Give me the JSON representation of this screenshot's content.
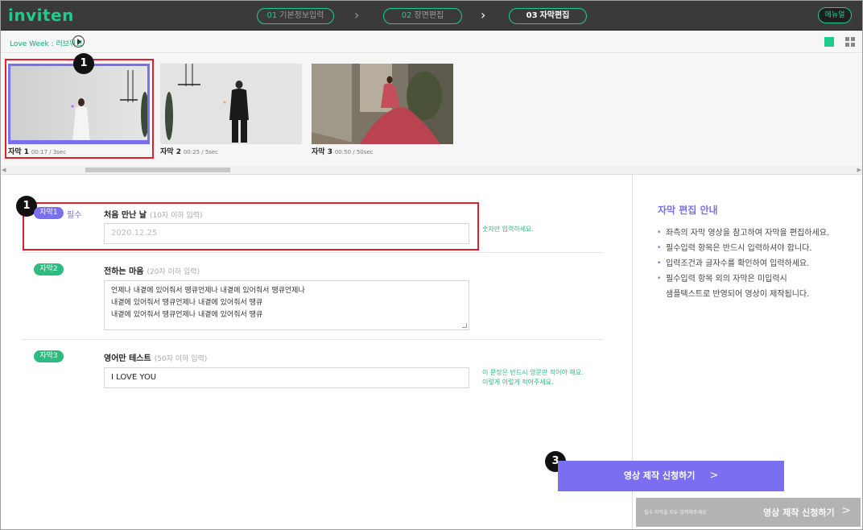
{
  "header": {
    "logo": "inviten",
    "steps": [
      {
        "num": "01",
        "label": "기본정보입력"
      },
      {
        "num": "02",
        "label": "장면편집"
      },
      {
        "num": "03",
        "label": "자막편집"
      }
    ],
    "menu_label": "메뉴얼",
    "accent": "#1dcc8c"
  },
  "subbar": {
    "project_title": "Love Week : 러브위크"
  },
  "filmstrip": {
    "thumbs": [
      {
        "name": "자막 1",
        "meta": "00:17 / 3sec"
      },
      {
        "name": "자막 2",
        "meta": "00:25 / 5sec"
      },
      {
        "name": "자막 3",
        "meta": "00:50 / 50sec"
      }
    ]
  },
  "annotations": {
    "badge1": "1",
    "badge1b": "1",
    "badge3": "3"
  },
  "form": {
    "rows": [
      {
        "tag": "자막1",
        "required": "필수",
        "title": "처음 만난 날",
        "hint": "(10자 이하 입력)",
        "placeholder": "2020.12.25",
        "side_hint": "숫자만 입력하세요."
      },
      {
        "tag": "자막2",
        "title": "전하는 마음",
        "hint": "(20자 이하 입력)",
        "lines": [
          "언제나 내곁에 있어줘서 땡큐언제나 내곁에 있어줘서 땡큐언제나",
          "내곁에 있어줘서 땡큐언제나 내곁에 있어줘서 땡큐",
          "내곁에 있어줘서 땡큐언제나 내곁에 있어줘서 땡큐"
        ]
      },
      {
        "tag": "자막3",
        "title": "영어만 테스트",
        "hint": "(50자 이하 입력)",
        "value": "I LOVE YOU",
        "side_hint_1": "이 문장은 반드시 영문만 적어야 해요.",
        "side_hint_2": "이렇게 이렇게 적어주세요."
      }
    ]
  },
  "guide": {
    "title": "자막 편집 안내",
    "items": [
      "좌측의 자막 영상을 참고하여 자막을 편집하세요.",
      "필수입력 항목은 반드시 입력하셔야 합니다.",
      "입력조건과 글자수를 확인하여 입력하세요.",
      "필수입력 항목 외의 자막은 미입력시",
      "샘플텍스트로 반영되어 영상이 제작됩니다."
    ]
  },
  "actions": {
    "submit_label": "영상 제작 신청하기",
    "submit_chevron": ">",
    "bottom_note": "필수 자막을 모두 입력해주세요",
    "bottom_label": "영상 제작 신청하기",
    "bottom_chevron": ">",
    "submit_color": "#7a6ff0"
  }
}
